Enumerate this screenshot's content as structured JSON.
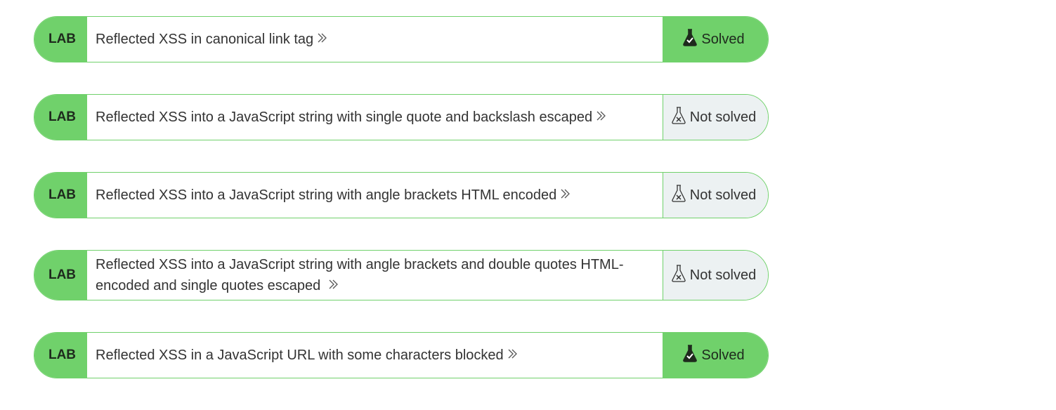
{
  "labs": [
    {
      "badge": "LAB",
      "title": "Reflected XSS in canonical link tag",
      "status": "Solved",
      "solved": true
    },
    {
      "badge": "LAB",
      "title": "Reflected XSS into a JavaScript string with single quote and backslash escaped",
      "status": "Not solved",
      "solved": false
    },
    {
      "badge": "LAB",
      "title": "Reflected XSS into a JavaScript string with angle brackets HTML encoded",
      "status": "Not solved",
      "solved": false
    },
    {
      "badge": "LAB",
      "title": "Reflected XSS into a JavaScript string with angle brackets and double quotes HTML-encoded and single quotes escaped",
      "status": "Not solved",
      "solved": false
    },
    {
      "badge": "LAB",
      "title": "Reflected XSS in a JavaScript URL with some characters blocked",
      "status": "Solved",
      "solved": true
    }
  ],
  "icons": {
    "title_arrow": "double-chevron-right-icon",
    "solved_icon": "flask-solved-icon",
    "not_solved_icon": "flask-not-solved-icon"
  },
  "colors": {
    "accent_green": "#70d16b",
    "not_solved_bg": "#ecf1f2",
    "text": "#333333"
  }
}
